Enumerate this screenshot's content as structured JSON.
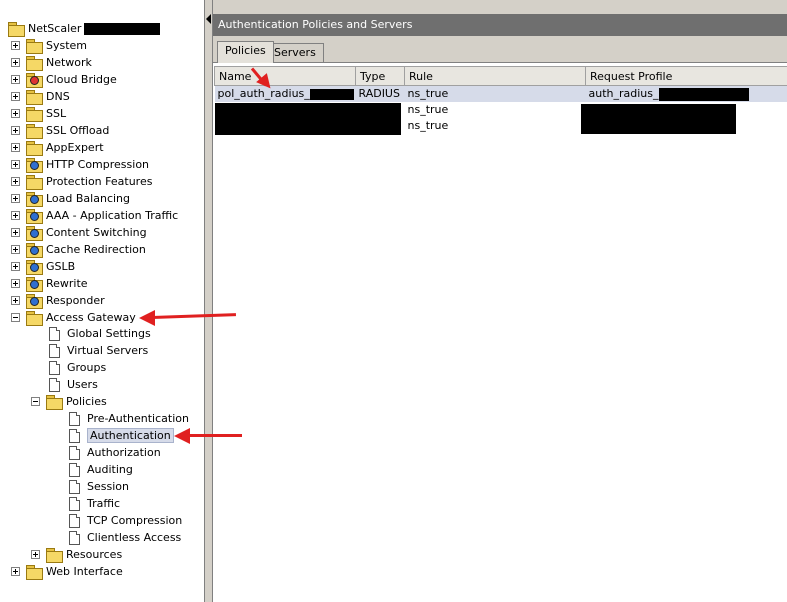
{
  "tree": {
    "root_label": "NetScaler",
    "items": [
      {
        "label": "System",
        "icon": "folder-icon"
      },
      {
        "label": "Network",
        "icon": "folder-icon"
      },
      {
        "label": "Cloud Bridge",
        "icon": "folder-red-icon"
      },
      {
        "label": "DNS",
        "icon": "folder-icon"
      },
      {
        "label": "SSL",
        "icon": "folder-icon"
      },
      {
        "label": "SSL Offload",
        "icon": "folder-icon"
      },
      {
        "label": "AppExpert",
        "icon": "folder-icon"
      },
      {
        "label": "HTTP Compression",
        "icon": "folder-info-icon"
      },
      {
        "label": "Protection Features",
        "icon": "folder-icon"
      },
      {
        "label": "Load Balancing",
        "icon": "folder-info-icon"
      },
      {
        "label": "AAA - Application Traffic",
        "icon": "folder-info-icon"
      },
      {
        "label": "Content Switching",
        "icon": "folder-info-icon"
      },
      {
        "label": "Cache Redirection",
        "icon": "folder-info-icon"
      },
      {
        "label": "GSLB",
        "icon": "folder-info-icon"
      },
      {
        "label": "Rewrite",
        "icon": "folder-info-icon"
      },
      {
        "label": "Responder",
        "icon": "folder-info-icon"
      },
      {
        "label": "Access Gateway",
        "icon": "folder-icon"
      }
    ],
    "access_gateway_children": [
      "Global Settings",
      "Virtual Servers",
      "Groups",
      "Users"
    ],
    "policies_label": "Policies",
    "policies_children": [
      "Pre-Authentication",
      "Authentication",
      "Authorization",
      "Auditing",
      "Session",
      "Traffic",
      "TCP Compression",
      "Clientless Access"
    ],
    "resources_label": "Resources",
    "web_interface_label": "Web Interface"
  },
  "panel": {
    "title": "Authentication Policies and Servers",
    "tabs": [
      {
        "label": "Policies",
        "active": true
      },
      {
        "label": "Servers",
        "active": false
      }
    ],
    "columns": [
      "Name",
      "Type",
      "Rule",
      "Request Profile"
    ],
    "rows": [
      {
        "name": "pol_auth_radius_",
        "type": "RADIUS",
        "rule": "ns_true",
        "profile": "auth_radius_"
      },
      {
        "name": "",
        "type": "",
        "rule": "ns_true",
        "profile": ""
      },
      {
        "name": "",
        "type": "",
        "rule": "ns_true",
        "profile": ""
      }
    ]
  },
  "colors": {
    "annotation_arrow": "#e02020",
    "selection": "#d6dbe9",
    "title_bar": "#6f6f6f"
  }
}
